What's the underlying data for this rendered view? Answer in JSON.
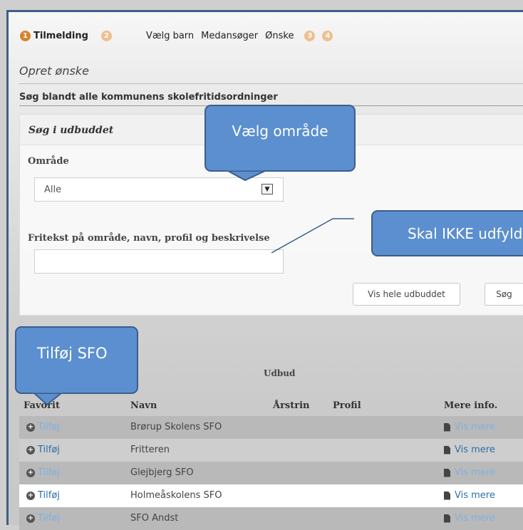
{
  "stepper": {
    "active_number": "1",
    "active_label": "Tilmelding",
    "steps": [
      "2",
      "3",
      "4"
    ],
    "substeps": [
      "Vælg barn",
      "Medansøger",
      "Ønske"
    ]
  },
  "page": {
    "title": "Opret ønske",
    "section_title": "Søg blandt alle kommunens skolefritidsordninger"
  },
  "search_panel": {
    "title": "Søg i udbuddet",
    "area_label": "Område",
    "area_value": "Alle",
    "text_label": "Fritekst på område, navn, profil og beskrivelse",
    "text_value": "",
    "show_all_label": "Vis hele udbuddet",
    "search_label": "Søg"
  },
  "results": {
    "label": "Udbud",
    "columns": {
      "favorite": "Favorit",
      "name": "Navn",
      "grade": "Årstrin",
      "profile": "Profil",
      "more": "Mere info."
    },
    "rows": [
      {
        "add": "Tilføj",
        "name": "Brørup Skolens SFO",
        "more": "Vis mere"
      },
      {
        "add": "Tilføj",
        "name": "Fritteren",
        "more": "Vis mere"
      },
      {
        "add": "Tilføj",
        "name": "Glejbjerg SFO",
        "more": "Vis mere"
      },
      {
        "add": "Tilføj",
        "name": "Holmeåskolens SFO",
        "more": "Vis mere"
      },
      {
        "add": "Tilføj",
        "name": "SFO Andst",
        "more": "Vis mere"
      }
    ]
  },
  "callouts": {
    "area": "Vælg område",
    "no_fill": "Skal IKKE udfyldes",
    "add_sfo": "Tilføj SFO"
  },
  "colors": {
    "accent_orange": "#d9822b",
    "callout_fill": "#5b8fcf",
    "callout_border": "#3b5e88",
    "link_blue": "#2c6fa8",
    "frame_border": "#3f5f88"
  },
  "icons": {
    "add": "plus-circle-icon",
    "more": "document-icon",
    "select": "chevron-down-icon"
  }
}
